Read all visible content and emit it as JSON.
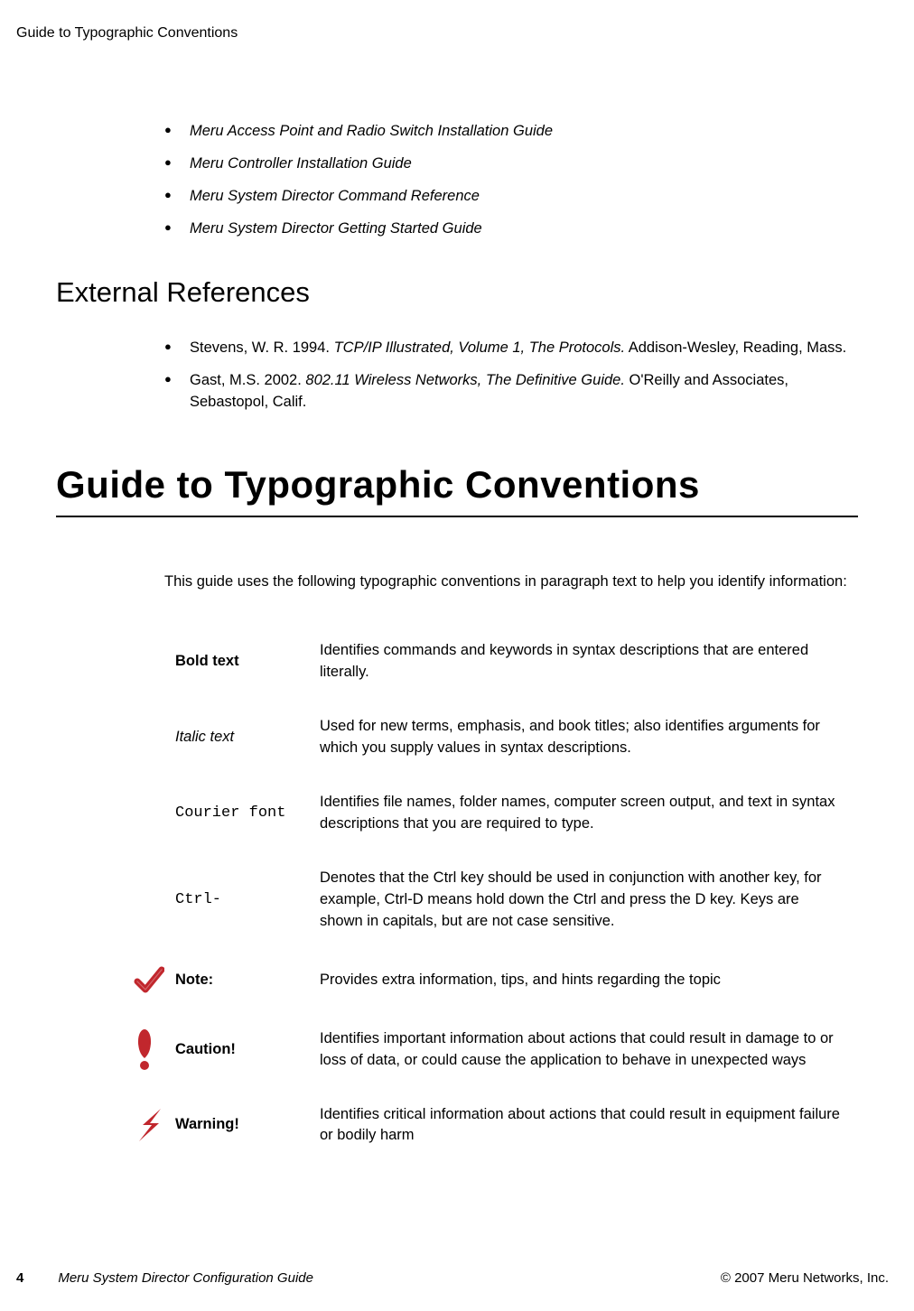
{
  "runningHeader": "Guide to Typographic Conventions",
  "meruRefs": [
    "Meru Access Point and Radio Switch Installation Guide",
    "Meru Controller Installation Guide",
    "Meru System Director Command Reference",
    "Meru System Director Getting Started Guide"
  ],
  "externalHeading": "External References",
  "extRefs": [
    {
      "pre": "Stevens, W. R. 1994. ",
      "title": "TCP/IP Illustrated, Volume 1, The Protocols.",
      "post": " Addison-Wesley, Reading, Mass."
    },
    {
      "pre": "Gast, M.S. 2002. ",
      "title": "802.11 Wireless Networks, The Definitive Guide.",
      "post": " O'Reilly and Associates, Sebastopol, Calif."
    }
  ],
  "majorHeading": "Guide to Typographic Conventions",
  "intro": "This guide uses the following typographic conventions in paragraph text to help you identify information:",
  "rows": {
    "bold": {
      "label": "Bold text",
      "desc": "Identifies commands and keywords in syntax descriptions that are entered literally."
    },
    "italic": {
      "label": "Italic text",
      "desc": "Used for new terms, emphasis, and book titles; also identifies arguments for which you supply values in syntax descriptions."
    },
    "courier": {
      "label": "Courier font",
      "desc": "Identifies file names, folder names, computer screen output, and text in syntax descriptions that you are required to type."
    },
    "ctrl": {
      "label": "Ctrl-",
      "desc": "Denotes that the Ctrl key should be used in conjunction with another key, for example, Ctrl-D means hold down the Ctrl and press the D key. Keys are shown in capitals, but are not case sensitive."
    },
    "note": {
      "label": "Note:",
      "desc": "Provides extra information, tips, and hints regarding the topic"
    },
    "caution": {
      "label": "Caution!",
      "desc": "Identifies important information about actions that could result in damage to or loss of data, or could cause the application to behave in unexpected ways"
    },
    "warning": {
      "label": "Warning!",
      "desc": "Identifies critical information about actions that could result in equipment failure or bodily harm"
    }
  },
  "footer": {
    "page": "4",
    "title": "Meru System Director Configuration Guide",
    "copyright": "© 2007 Meru Networks, Inc."
  }
}
